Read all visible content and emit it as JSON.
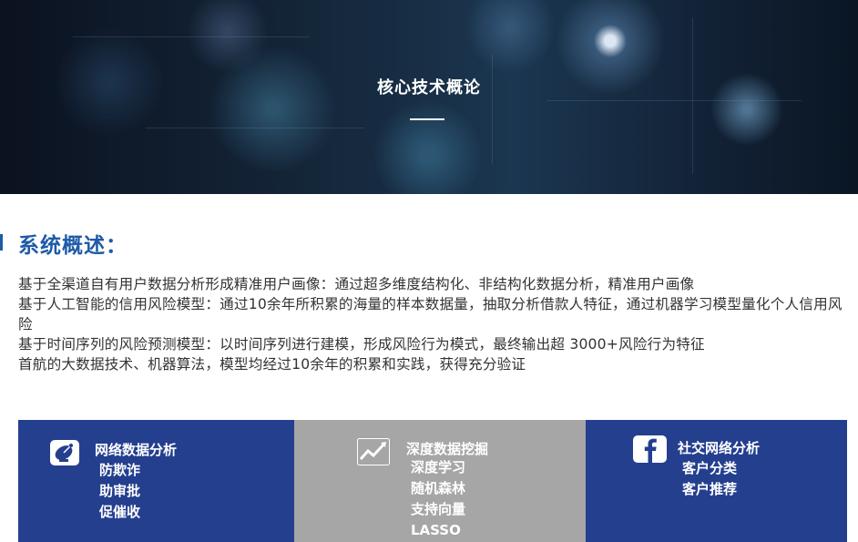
{
  "banner": {
    "title": "核心技术概论"
  },
  "section": {
    "title": "系统概述：",
    "paragraphs": [
      "基于全渠道自有用户数据分析形成精准用户画像：通过超多维度结构化、非结构化数据分析，精准用户画像",
      "基于人工智能的信用风险模型：通过10余年所积累的海量的样本数据量，抽取分析借款人特征，通过机器学习模型量化个人信用风险",
      "基于时间序列的风险预测模型：以时间序列进行建模，形成风险行为模式，最终输出超 3000+风险行为特征",
      "首航的大数据技术、机器算法，模型均经过10余年的积累和实践，获得充分验证"
    ]
  },
  "cards": [
    {
      "icon": "satellite-dish-icon",
      "title": "网络数据分析",
      "items": [
        "防欺诈",
        "助审批",
        "促催收"
      ],
      "color": "#253f8f"
    },
    {
      "icon": "trend-chart-icon",
      "title": "深度数据挖掘",
      "items": [
        "深度学习",
        "随机森林",
        "支持向量",
        "LASSO"
      ],
      "color": "#a6a6a6"
    },
    {
      "icon": "facebook-icon",
      "title": "社交网络分析",
      "items": [
        "客户分类",
        "客户推荐"
      ],
      "color": "#253f8f"
    }
  ]
}
